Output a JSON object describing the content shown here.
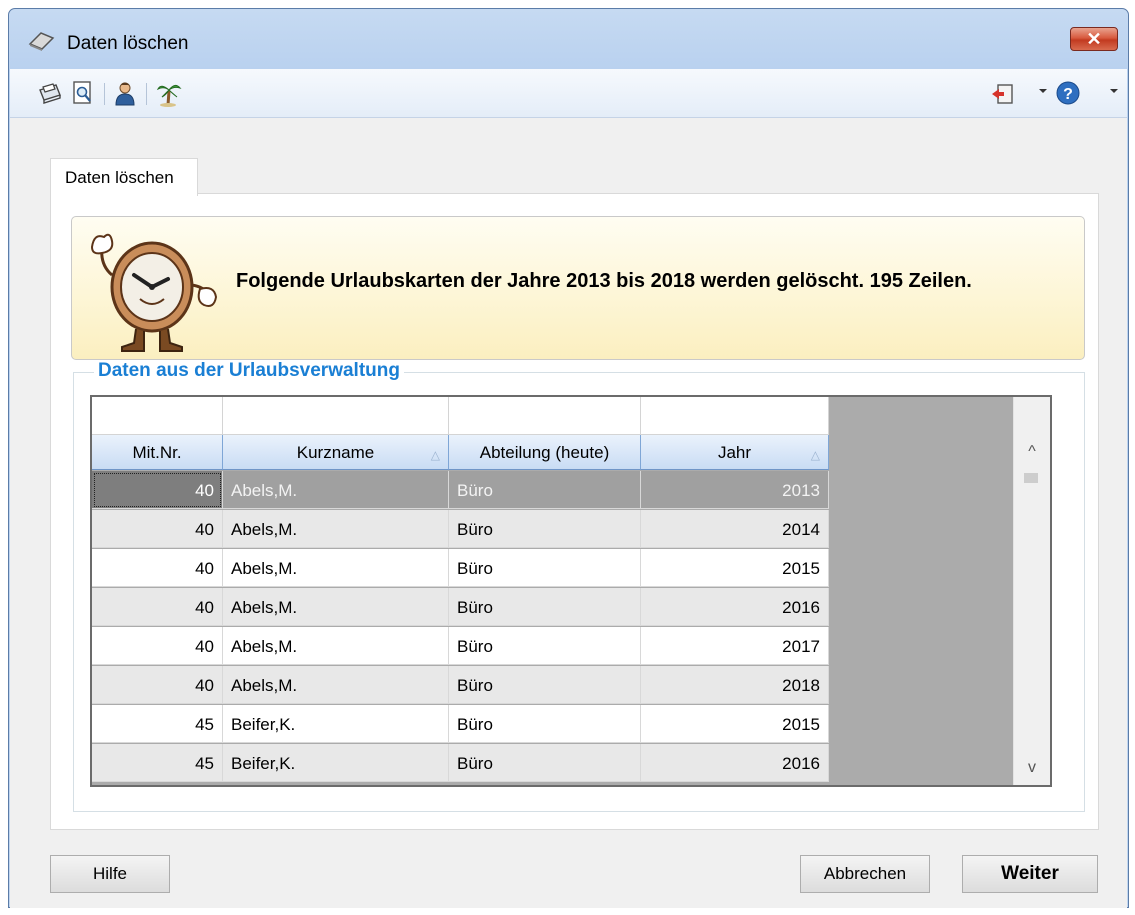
{
  "window": {
    "title": "Daten löschen",
    "close_label": "✕"
  },
  "toolbar": {
    "left_icons": [
      "printer-icon",
      "print-preview-icon",
      "user-icon",
      "palm-tree-icon"
    ],
    "right_icons": [
      "exit-door-icon",
      "help-icon"
    ]
  },
  "tab": {
    "label": "Daten löschen"
  },
  "banner": {
    "message": "Folgende Urlaubskarten der Jahre 2013 bis 2018 werden gelöscht. 195 Zeilen."
  },
  "group": {
    "title": "Daten aus der Urlaubsverwaltung"
  },
  "table": {
    "columns": [
      "Mit.Nr.",
      "Kurzname",
      "Abteilung (heute)",
      "Jahr"
    ],
    "sorted_columns": [
      "Kurzname",
      "Jahr"
    ],
    "rows": [
      [
        "40",
        "Abels,M.",
        "Büro",
        "2013"
      ],
      [
        "40",
        "Abels,M.",
        "Büro",
        "2014"
      ],
      [
        "40",
        "Abels,M.",
        "Büro",
        "2015"
      ],
      [
        "40",
        "Abels,M.",
        "Büro",
        "2016"
      ],
      [
        "40",
        "Abels,M.",
        "Büro",
        "2017"
      ],
      [
        "40",
        "Abels,M.",
        "Büro",
        "2018"
      ],
      [
        "45",
        "Beifer,K.",
        "Büro",
        "2015"
      ],
      [
        "45",
        "Beifer,K.",
        "Büro",
        "2016"
      ]
    ],
    "selected_row": 0
  },
  "buttons": {
    "help": "Hilfe",
    "cancel": "Abbrechen",
    "next": "Weiter"
  },
  "colors": {
    "group_title": "#1a7fd4",
    "selected_row": "#a0a0a0",
    "header": "#c9dcf4"
  }
}
